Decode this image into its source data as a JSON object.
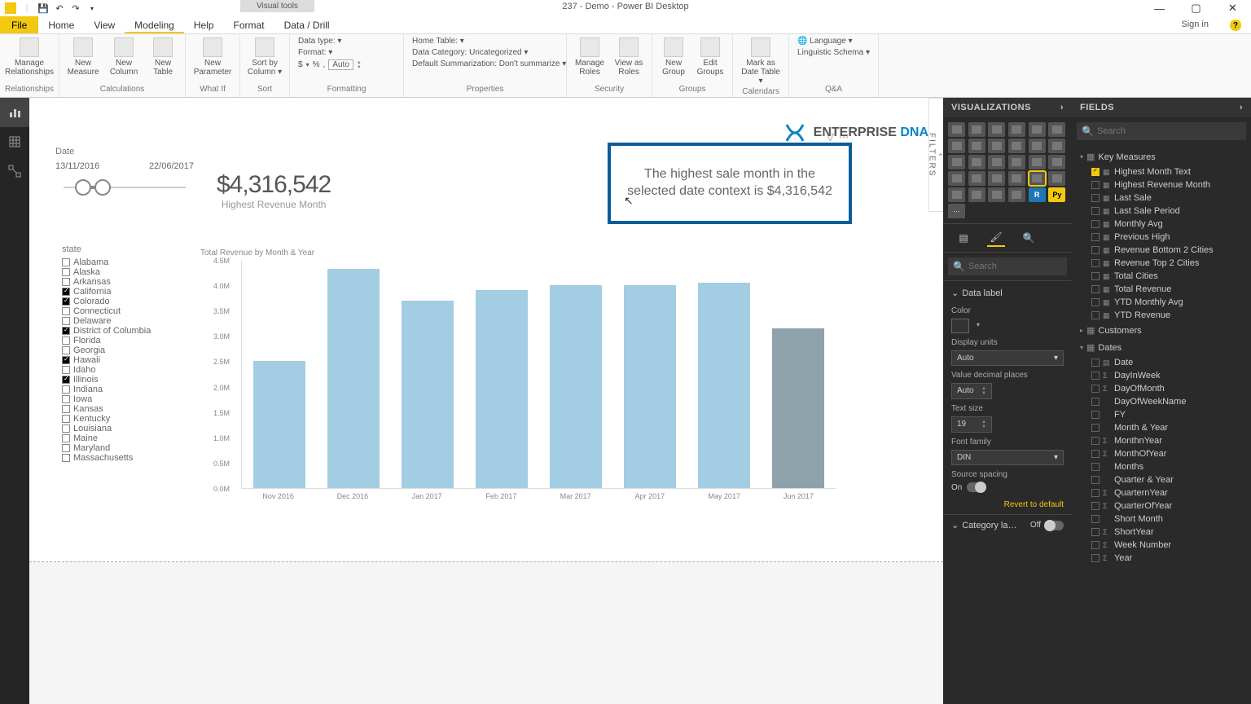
{
  "titlebar": {
    "visual_tools": "Visual tools",
    "title": "237 - Demo - Power BI Desktop"
  },
  "window": {
    "min": "—",
    "max": "▢",
    "close": "✕"
  },
  "qat": {
    "save": "💾",
    "undo": "↶",
    "redo": "↷",
    "more": "▾"
  },
  "ribbon_tabs": {
    "file": "File",
    "home": "Home",
    "view": "View",
    "modeling": "Modeling",
    "help": "Help",
    "format": "Format",
    "datadrill": "Data / Drill"
  },
  "signin": "Sign in",
  "ribbon": {
    "relationships": {
      "manage": "Manage\nRelationships",
      "group": "Relationships"
    },
    "calculations": {
      "measure": "New\nMeasure",
      "column": "New\nColumn",
      "table": "New\nTable",
      "group": "Calculations"
    },
    "whatif": {
      "param": "New\nParameter",
      "group": "What If"
    },
    "sort": {
      "sort": "Sort by\nColumn ▾",
      "group": "Sort"
    },
    "formatting": {
      "datatype": "Data type:  ▾",
      "format": "Format:  ▾",
      "dollar": "$",
      "percent": "%",
      "comma": ",",
      "auto": "Auto",
      "group": "Formatting"
    },
    "properties": {
      "hometable": "Home Table:  ▾",
      "category": "Data Category: Uncategorized ▾",
      "summarization": "Default Summarization: Don't summarize ▾",
      "group": "Properties"
    },
    "security": {
      "manage_roles": "Manage\nRoles",
      "view_as": "View as\nRoles",
      "group": "Security"
    },
    "groups": {
      "new": "New\nGroup",
      "edit": "Edit\nGroups",
      "group": "Groups"
    },
    "calendars": {
      "mark": "Mark as\nDate Table ▾",
      "group": "Calendars"
    },
    "qa": {
      "lang": "Language ▾",
      "schema": "Linguistic Schema ▾",
      "group": "Q&A"
    }
  },
  "slicer_date": {
    "label": "Date",
    "from": "13/11/2016",
    "to": "22/06/2017"
  },
  "kpi": {
    "value": "$4,316,542",
    "label": "Highest Revenue Month"
  },
  "brand": {
    "name": "ENTERPRISE ",
    "accent": "DNA"
  },
  "text_card": {
    "text": "The highest sale month in the selected date context is $4,316,542"
  },
  "state_slicer": {
    "label": "state",
    "items": [
      {
        "name": "Alabama",
        "checked": false
      },
      {
        "name": "Alaska",
        "checked": false
      },
      {
        "name": "Arkansas",
        "checked": false
      },
      {
        "name": "California",
        "checked": true
      },
      {
        "name": "Colorado",
        "checked": true
      },
      {
        "name": "Connecticut",
        "checked": false
      },
      {
        "name": "Delaware",
        "checked": false
      },
      {
        "name": "District of Columbia",
        "checked": true
      },
      {
        "name": "Florida",
        "checked": false
      },
      {
        "name": "Georgia",
        "checked": false
      },
      {
        "name": "Hawaii",
        "checked": true
      },
      {
        "name": "Idaho",
        "checked": false
      },
      {
        "name": "Illinois",
        "checked": true
      },
      {
        "name": "Indiana",
        "checked": false
      },
      {
        "name": "Iowa",
        "checked": false
      },
      {
        "name": "Kansas",
        "checked": false
      },
      {
        "name": "Kentucky",
        "checked": false
      },
      {
        "name": "Louisiana",
        "checked": false
      },
      {
        "name": "Maine",
        "checked": false
      },
      {
        "name": "Maryland",
        "checked": false
      },
      {
        "name": "Massachusetts",
        "checked": false
      }
    ]
  },
  "chart_data": {
    "type": "bar",
    "title": "Total Revenue by Month & Year",
    "y_ticks": [
      "4.5M",
      "4.0M",
      "3.5M",
      "3.0M",
      "2.5M",
      "2.0M",
      "1.5M",
      "1.0M",
      "0.5M",
      "0.0M"
    ],
    "ylim": [
      0,
      4500000
    ],
    "categories": [
      "Nov 2016",
      "Dec 2016",
      "Jan 2017",
      "Feb 2017",
      "Mar 2017",
      "Apr 2017",
      "May 2017",
      "Jun 2017"
    ],
    "values": [
      2500000,
      4316542,
      3700000,
      3900000,
      4000000,
      4000000,
      4050000,
      3150000
    ],
    "highlight_index": 7
  },
  "filters_tab": "FILTERS",
  "viz_panel": {
    "title": "VISUALIZATIONS",
    "search_placeholder": "Search",
    "sections": {
      "data_label": "Data label",
      "color": "Color",
      "display_units": "Display units",
      "display_units_val": "Auto",
      "decimal": "Value decimal places",
      "decimal_val": "Auto",
      "text_size": "Text size",
      "text_size_val": "19",
      "font_family": "Font family",
      "font_family_val": "DIN",
      "source_spacing": "Source spacing",
      "on": "On",
      "category": "Category la…",
      "off": "Off",
      "revert": "Revert to default"
    }
  },
  "fields_panel": {
    "title": "FIELDS",
    "search_placeholder": "Search",
    "groups": [
      {
        "name": "Key Measures",
        "expanded": true,
        "items": [
          {
            "name": "Highest Month Text",
            "checked": true,
            "icon": "▦"
          },
          {
            "name": "Highest Revenue Month",
            "checked": false,
            "icon": "▦"
          },
          {
            "name": "Last Sale",
            "checked": false,
            "icon": "▦"
          },
          {
            "name": "Last Sale Period",
            "checked": false,
            "icon": "▦"
          },
          {
            "name": "Monthly Avg",
            "checked": false,
            "icon": "▦"
          },
          {
            "name": "Previous High",
            "checked": false,
            "icon": "▦"
          },
          {
            "name": "Revenue Bottom 2 Cities",
            "checked": false,
            "icon": "▦"
          },
          {
            "name": "Revenue Top 2 Cities",
            "checked": false,
            "icon": "▦"
          },
          {
            "name": "Total Cities",
            "checked": false,
            "icon": "▦"
          },
          {
            "name": "Total Revenue",
            "checked": false,
            "icon": "▦"
          },
          {
            "name": "YTD Monthly Avg",
            "checked": false,
            "icon": "▦"
          },
          {
            "name": "YTD Revenue",
            "checked": false,
            "icon": "▦"
          }
        ]
      },
      {
        "name": "Customers",
        "expanded": false,
        "items": []
      },
      {
        "name": "Dates",
        "expanded": true,
        "items": [
          {
            "name": "Date",
            "checked": false,
            "icon": "▤"
          },
          {
            "name": "DayInWeek",
            "checked": false,
            "icon": "Σ"
          },
          {
            "name": "DayOfMonth",
            "checked": false,
            "icon": "Σ"
          },
          {
            "name": "DayOfWeekName",
            "checked": false,
            "icon": ""
          },
          {
            "name": "FY",
            "checked": false,
            "icon": ""
          },
          {
            "name": "Month & Year",
            "checked": false,
            "icon": ""
          },
          {
            "name": "MonthnYear",
            "checked": false,
            "icon": "Σ"
          },
          {
            "name": "MonthOfYear",
            "checked": false,
            "icon": "Σ"
          },
          {
            "name": "Months",
            "checked": false,
            "icon": ""
          },
          {
            "name": "Quarter & Year",
            "checked": false,
            "icon": ""
          },
          {
            "name": "QuarternYear",
            "checked": false,
            "icon": "Σ"
          },
          {
            "name": "QuarterOfYear",
            "checked": false,
            "icon": "Σ"
          },
          {
            "name": "Short Month",
            "checked": false,
            "icon": ""
          },
          {
            "name": "ShortYear",
            "checked": false,
            "icon": "Σ"
          },
          {
            "name": "Week Number",
            "checked": false,
            "icon": "Σ"
          },
          {
            "name": "Year",
            "checked": false,
            "icon": "Σ"
          }
        ]
      }
    ]
  }
}
